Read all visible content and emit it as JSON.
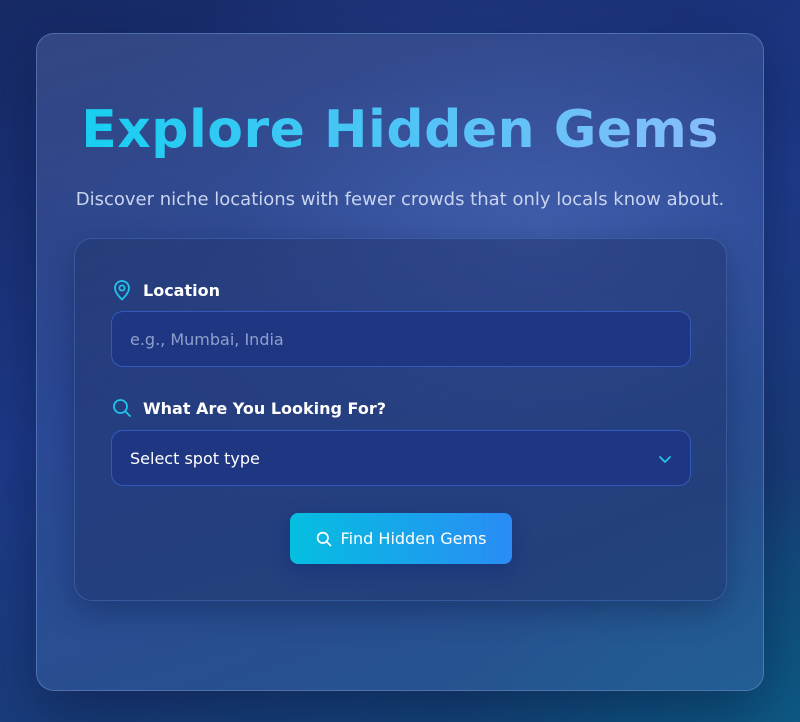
{
  "header": {
    "title": "Explore Hidden Gems",
    "subtitle": "Discover niche locations with fewer crowds that only locals know about."
  },
  "form": {
    "location": {
      "label": "Location",
      "icon": "map-pin-icon",
      "placeholder": "e.g., Mumbai, India",
      "value": ""
    },
    "spot_type": {
      "label": "What Are You Looking For?",
      "icon": "search-icon",
      "selected": "Select spot type",
      "dropdown_icon": "chevron-down-icon"
    },
    "submit": {
      "label": "Find Hidden Gems",
      "icon": "search-icon"
    }
  },
  "colors": {
    "accent_cyan": "#10d0f0",
    "accent_blue": "#2a8cf5",
    "input_bg": "#1f3682",
    "icon_cyan": "#22c4ea"
  }
}
